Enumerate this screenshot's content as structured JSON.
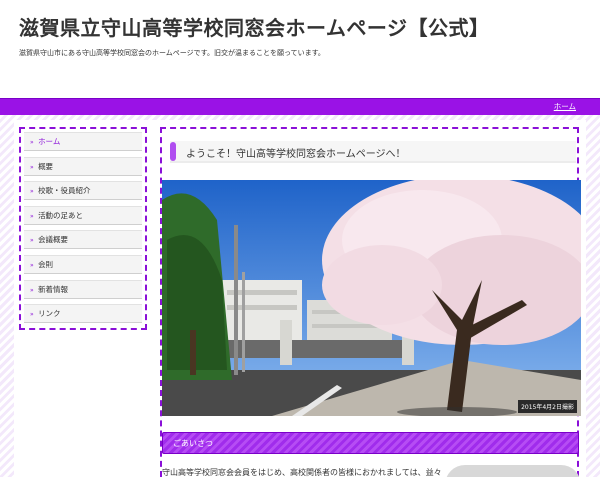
{
  "header": {
    "title": "滋賀県立守山高等学校同窓会ホームページ【公式】",
    "description": "滋賀県守山市にある守山高等学校同窓会のホームページです。旧交が温まることを願っています。"
  },
  "nav": {
    "home_link": "ホーム"
  },
  "sidebar": {
    "arrow": "»",
    "items": [
      {
        "label": "ホーム"
      },
      {
        "label": "概要"
      },
      {
        "label": "校歌・役員紹介"
      },
      {
        "label": "活動の足あと"
      },
      {
        "label": "会議概要"
      },
      {
        "label": "会則"
      },
      {
        "label": "新着情報"
      },
      {
        "label": "リンク"
      }
    ]
  },
  "main": {
    "welcome": "ようこそ！守山高等学校同窓会ホームページへ！",
    "photo_caption": "2015年4月2日撮影",
    "greeting_heading": "ごあいさつ",
    "greeting_text": "守山高等学校同窓会会員をはじめ、高校関係者の皆様におかれましては、益々"
  },
  "colors": {
    "accent": "#9a12e6",
    "accent_dark": "#7a00c8",
    "stripe": "#f3e8fb"
  }
}
